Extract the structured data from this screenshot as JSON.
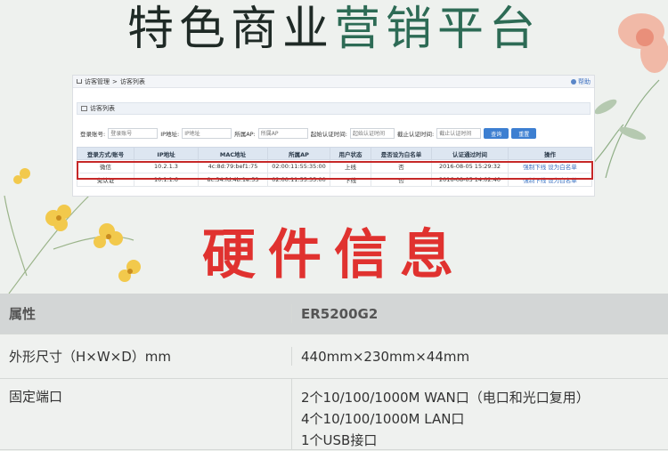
{
  "headline": {
    "part1": "特色商业",
    "part2": "营销平台"
  },
  "panel": {
    "breadcrumb": {
      "root": "访客管理",
      "separator": ">",
      "current": "访客列表"
    },
    "help_label": "帮助",
    "section_title": "访客列表",
    "filters": [
      {
        "label": "登录账号:",
        "placeholder": "登录账号"
      },
      {
        "label": "IP地址:",
        "placeholder": "IP地址"
      },
      {
        "label": "所属AP:",
        "placeholder": "所属AP"
      },
      {
        "label": "起始认证时间:",
        "placeholder": "起始认证时间"
      },
      {
        "label": "截止认证时间:",
        "placeholder": "截止认证时间"
      }
    ],
    "search_button": "查询",
    "reset_button": "重置",
    "columns": [
      "登录方式/账号",
      "IP地址",
      "MAC地址",
      "所属AP",
      "用户状态",
      "是否设为白名单",
      "认证通过时间",
      "操作"
    ],
    "rows": [
      [
        "微信",
        "10.2.1.3",
        "4c:8d:79:bef1:75",
        "02:00:11:55:35:00",
        "上线",
        "否",
        "2016-08-05 15:29:32",
        "强制下线 设为白名单"
      ],
      [
        "免认证",
        "10.1.1.6",
        "8c:34:fd:4b:1e:53",
        "02:00:11:55:35:00",
        "下线",
        "否",
        "2016-08-05 14:02:40",
        "强制下线 设为白名单"
      ]
    ]
  },
  "subtitle": "硬件信息",
  "spec": {
    "header_key": "属性",
    "header_value": "ER5200G2",
    "rows": [
      {
        "key": "外形尺寸（H×W×D）mm",
        "values": [
          "440mm×230mm×44mm"
        ]
      },
      {
        "key": "固定端口",
        "values": [
          "2个10/100/1000M WAN口（电口和光口复用）",
          "4个10/100/1000M LAN口",
          "1个USB接口"
        ]
      }
    ]
  },
  "colors": {
    "headline_dark": "#1f2a26",
    "headline_green": "#2d6b55",
    "subtitle_red": "#e0322f",
    "highlight_red": "#c62828",
    "button_blue": "#3d7fd1"
  }
}
